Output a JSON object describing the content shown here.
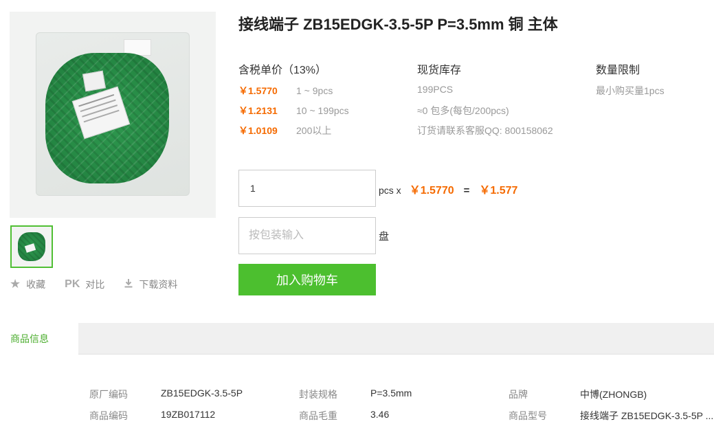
{
  "product": {
    "title": "接线端子 ZB15EDGK-3.5-5P P=3.5mm 铜 主体",
    "image_alt": "green terminal blocks in bag"
  },
  "actions": [
    {
      "icon": "star-icon",
      "label": "收藏"
    },
    {
      "icon": "pk-icon",
      "icon_text": "PK",
      "label": "对比"
    },
    {
      "icon": "download-icon",
      "label": "下载资料"
    }
  ],
  "pricing": {
    "header": "含税单价（13%）",
    "tiers": [
      {
        "price": "￥1.5770",
        "range": "1 ~ 9pcs"
      },
      {
        "price": "￥1.2131",
        "range": "10 ~ 199pcs"
      },
      {
        "price": "￥1.0109",
        "range": "200以上"
      }
    ]
  },
  "stock": {
    "header": "现货库存",
    "lines": [
      "199PCS",
      "≈0 包多(每包/200pcs)",
      "订货请联系客服QQ: 800158062"
    ]
  },
  "limit": {
    "header": "数量限制",
    "text": "最小购买量1pcs"
  },
  "order": {
    "quantity_value": "1",
    "unit_times": "pcs x",
    "unit_price": "￥1.5770",
    "equals": "=",
    "total": "￥1.577",
    "package_placeholder": "按包装输入",
    "package_unit": "盘",
    "add_to_cart": "加入购物车"
  },
  "tabs": [
    {
      "label": "商品信息",
      "active": true
    }
  ],
  "specs": [
    {
      "key": "原厂编码",
      "value": "ZB15EDGK-3.5-5P"
    },
    {
      "key": "封装规格",
      "value": "P=3.5mm"
    },
    {
      "key": "品牌",
      "value": "中博(ZHONGB)"
    },
    {
      "key": "商品编码",
      "value": "19ZB017112"
    },
    {
      "key": "商品毛重",
      "value": "3.46"
    },
    {
      "key": "商品型号",
      "value": "接线端子 ZB15EDGK-3.5-5P ..."
    }
  ],
  "colors": {
    "price": "#f56a00",
    "accent": "#4cbf2f",
    "tab_active": "#4cae2f"
  }
}
